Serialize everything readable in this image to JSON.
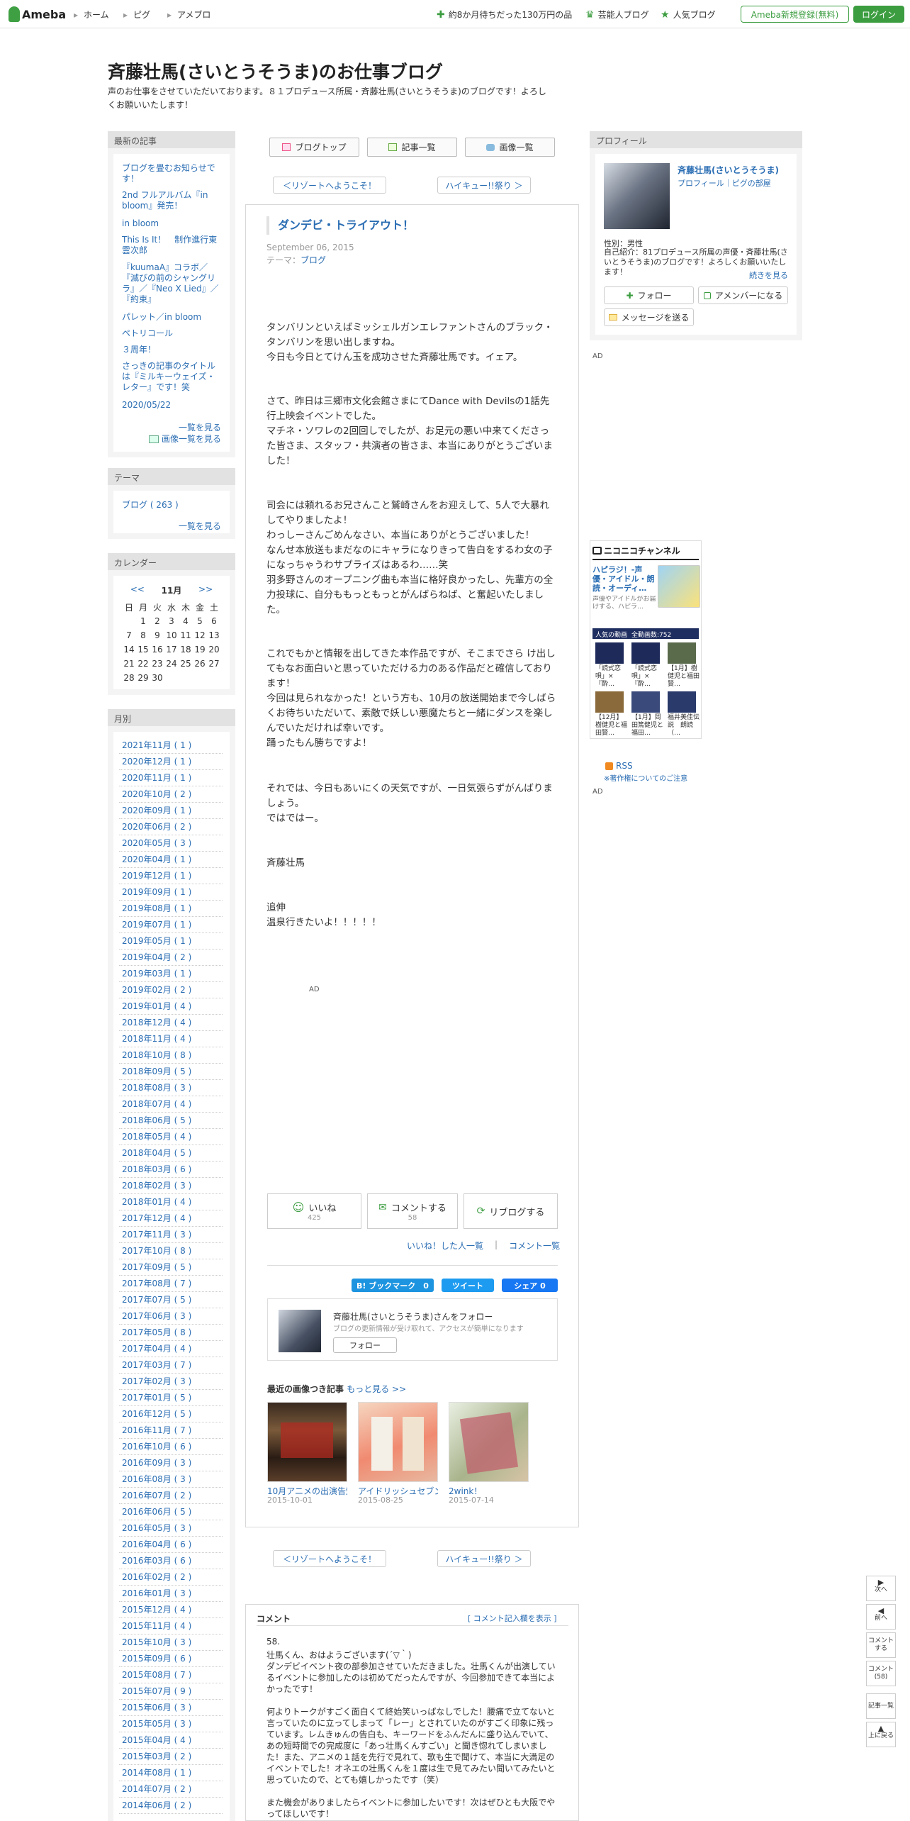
{
  "topbar": {
    "logo": "Ameba",
    "nav": [
      "ホーム",
      "ピグ",
      "アメブロ"
    ],
    "links": [
      "約8か月待ちだった130万円の品",
      "芸能人ブログ",
      "人気ブログ"
    ],
    "register": "Ameba新規登録(無料)",
    "login": "ログイン"
  },
  "blog": {
    "title": "斉藤壮馬(さいとうそうま)のお仕事ブログ",
    "desc": "声のお仕事をさせていただいております。８１プロデュース所属・斉藤壮馬(さいとうそうま)のブログです！よろしくお願いいたします！"
  },
  "recent": {
    "heading": "最新の記事",
    "items": [
      "ブログを畳むお知らせです！",
      "2nd フルアルバム『in bloom』発売！",
      "in bloom",
      "This Is It！　制作進行東雲次郎",
      "『kuumaA』コラボ／『滅びの前のシャングリラ』／『Neo X Lied』／『約束』",
      "パレット／in bloom",
      "ペトリコール",
      "３周年！",
      "さっきの記事のタイトルは『ミルキーウェイズ・レター』です！笑",
      "2020/05/22"
    ],
    "more": "一覧を見る",
    "images": "画像一覧を見る"
  },
  "theme": {
    "heading": "テーマ",
    "item": "ブログ ( 263 )",
    "more": "一覧を見る"
  },
  "calendar": {
    "heading": "カレンダー",
    "prev": "<<",
    "month": "11月",
    "next": ">>",
    "days": [
      "日",
      "月",
      "火",
      "水",
      "木",
      "金",
      "土"
    ],
    "weeks": [
      [
        "",
        "1",
        "2",
        "3",
        "4",
        "5",
        "6"
      ],
      [
        "7",
        "8",
        "9",
        "10",
        "11",
        "12",
        "13"
      ],
      [
        "14",
        "15",
        "16",
        "17",
        "18",
        "19",
        "20"
      ],
      [
        "21",
        "22",
        "23",
        "24",
        "25",
        "26",
        "27"
      ],
      [
        "28",
        "29",
        "30",
        "",
        "",
        "",
        ""
      ]
    ]
  },
  "monthly": {
    "heading": "月別",
    "items": [
      "2021年11月 ( 1 )",
      "2020年12月 ( 1 )",
      "2020年11月 ( 1 )",
      "2020年10月 ( 2 )",
      "2020年09月 ( 1 )",
      "2020年06月 ( 2 )",
      "2020年05月 ( 3 )",
      "2020年04月 ( 1 )",
      "2019年12月 ( 1 )",
      "2019年09月 ( 1 )",
      "2019年08月 ( 1 )",
      "2019年07月 ( 1 )",
      "2019年05月 ( 1 )",
      "2019年04月 ( 2 )",
      "2019年03月 ( 1 )",
      "2019年02月 ( 2 )",
      "2019年01月 ( 4 )",
      "2018年12月 ( 4 )",
      "2018年11月 ( 4 )",
      "2018年10月 ( 8 )",
      "2018年09月 ( 5 )",
      "2018年08月 ( 3 )",
      "2018年07月 ( 4 )",
      "2018年06月 ( 5 )",
      "2018年05月 ( 4 )",
      "2018年04月 ( 5 )",
      "2018年03月 ( 6 )",
      "2018年02月 ( 3 )",
      "2018年01月 ( 4 )",
      "2017年12月 ( 4 )",
      "2017年11月 ( 3 )",
      "2017年10月 ( 8 )",
      "2017年09月 ( 5 )",
      "2017年08月 ( 7 )",
      "2017年07月 ( 5 )",
      "2017年06月 ( 3 )",
      "2017年05月 ( 8 )",
      "2017年04月 ( 4 )",
      "2017年03月 ( 7 )",
      "2017年02月 ( 3 )",
      "2017年01月 ( 5 )",
      "2016年12月 ( 5 )",
      "2016年11月 ( 7 )",
      "2016年10月 ( 6 )",
      "2016年09月 ( 3 )",
      "2016年08月 ( 3 )",
      "2016年07月 ( 2 )",
      "2016年06月 ( 5 )",
      "2016年05月 ( 3 )",
      "2016年04月 ( 6 )",
      "2016年03月 ( 6 )",
      "2016年02月 ( 2 )",
      "2016年01月 ( 3 )",
      "2015年12月 ( 4 )",
      "2015年11月 ( 4 )",
      "2015年10月 ( 3 )",
      "2015年09月 ( 6 )",
      "2015年08月 ( 7 )",
      "2015年07月 ( 9 )",
      "2015年06月 ( 3 )",
      "2015年05月 ( 3 )",
      "2015年04月 ( 4 )",
      "2015年03月 ( 2 )",
      "2014年08月 ( 1 )",
      "2014年07月 ( 2 )",
      "2014年06月 ( 2 )"
    ]
  },
  "tabs": {
    "top": "ブログトップ",
    "list": "記事一覧",
    "images": "画像一覧"
  },
  "pager": {
    "prev": "＜リゾートへようこそ！",
    "next": "ハイキュー!!祭り ＞"
  },
  "article": {
    "title": "ダンデビ・トライアウト！",
    "date": "September 06, 2015",
    "theme_label": "テーマ：",
    "theme": "ブログ",
    "p1": "タンバリンといえばミッシェルガンエレファントさんのブラック・タンバリンを思い出しますね。\n今日も今日とてけん玉を成功させた斉藤壮馬です。イェア。",
    "p2": "さて、昨日は三郷市文化会館さまにてDance with Devilsの1話先行上映会イベントでした。\nマチネ・ソワレの2回回しでしたが、お足元の悪い中来てくださった皆さま、スタッフ・共演者の皆さま、本当にありがとうございました！",
    "p3": "司会には頼れるお兄さんこと鷲崎さんをお迎えして、5人で大暴れしてやりましたよ！\nわっしーさんごめんなさい、本当にありがとうございました！\nなんせ本放送もまだなのにキャラになりきって告白をするわ女の子になっちゃうわサプライズはあるわ……笑\n羽多野さんのオープニング曲も本当に格好良かったし、先輩方の全力投球に、自分ももっともっとがんばらねば、と奮起いたしました。",
    "p4": "これでもかと情報を出してきた本作品ですが、そこまでさら け出してもなお面白いと思っていただける力のある作品だと確信しております！\n今回は見られなかった！という方も、10月の放送開始まで今しばらくお待ちいただいて、素敵で妖しい悪魔たちと一緒にダンスを楽しんでいただければ幸いです。\n踊ったもん勝ちですよ！",
    "p5": "それでは、今日もあいにくの天気ですが、一日気張らずがんばりましょう。\nではではー。",
    "p6": "斉藤壮馬",
    "p7": "追伸\n温泉行きたいよ！！！！！",
    "ad": "AD"
  },
  "actions": {
    "like": "いいね",
    "like_count": "425",
    "comment": "コメントする",
    "comment_count": "58",
    "reblog": "リブログする",
    "liked_by": "いいね！した人一覧",
    "comment_list": "コメント一覧"
  },
  "share": {
    "hatena": "B! ブックマーク　0",
    "tweet": "ツイート",
    "fb": "シェア 0"
  },
  "follow": {
    "title": "斉藤壮馬(さいとうそうま)さんをフォロー",
    "sub": "ブログの更新情報が受け取れて、アクセスが簡単になります",
    "btn": "フォロー"
  },
  "recent_images": {
    "heading": "最近の画像つき記事",
    "more": "もっと見る >>",
    "items": [
      {
        "cap": "10月アニメの出演告知！",
        "date": "2015-10-01"
      },
      {
        "cap": "アイドリッシュセブン…",
        "date": "2015-08-25"
      },
      {
        "cap": "2wink！",
        "date": "2015-07-14"
      }
    ]
  },
  "profile": {
    "heading": "プロフィール",
    "name": "斉藤壮馬(さいとうそうま)",
    "links": "プロフィール｜ピグの部屋",
    "gender": "性別：男性",
    "intro": "自己紹介：81プロデュース所属の声優・斉藤壮馬(さいとうそうま)のブログです！よろしくお願いいたします！",
    "more": "続きを見る",
    "follow": "フォロー",
    "member": "アメンバーになる",
    "message": "メッセージを送る"
  },
  "ad_label": "AD",
  "nico": {
    "logo": "ニコニコチャンネル",
    "title": "ハピラジ！-声優・アイドル・朗読・オーディ…",
    "desc": "声優やアイドルがお届けする、ハピラ…",
    "bar_label": "人気の動画",
    "bar_count": "全動画数:752",
    "captions": [
      "「読式恋唄」×『酔…",
      "「読式恋唄」×『酔…",
      "【1月】樹健児と福田賢…",
      "【12月】樹健児と福田賢…",
      "【1月】岡田篤健児と福田…",
      "福井美佳伝説　朗読（…"
    ]
  },
  "rss": "RSS",
  "copyright_note": "※著作権についてのご注意",
  "comments": {
    "heading": "コメント",
    "toggle": "[ コメント記入欄を表示 ]",
    "num": "58.",
    "body": "壮馬くん、おはようございます(´▽｀)\nダンデビイベント夜の部参加させていただきました。壮馬くんが出演しているイベントに参加したのは初めてだったんですが、今回参加できて本当によかったです！\n\n何よりトークがすごく面白くて終始笑いっぱなしでした！腰痛で立てないと言っていたのに立ってしまって「レー」とされていたのがすごく印象に残っています。レムきゅんの告白も、キーワードをふんだんに盛り込んでいて、あの短時間での完成度に「あっ壮馬くんすごい」と聞き惚れてしまいました！また、アニメの１話を先行で見れて、歌も生で聞けて、本当に大満足のイベントでした！オネエの壮馬くんを１度は生で見てみたい聞いてみたいと思っていたので、とても嬉しかったです（笑）\n\nまた機会がありましたらイベントに参加したいです！次はぜひとも大阪でやってほしいです！"
  },
  "floatnav": {
    "next": "次へ",
    "prev": "前へ",
    "comment": "コメントする",
    "comment_count": "コメント(58)",
    "list": "記事一覧",
    "top": "上に戻る"
  }
}
